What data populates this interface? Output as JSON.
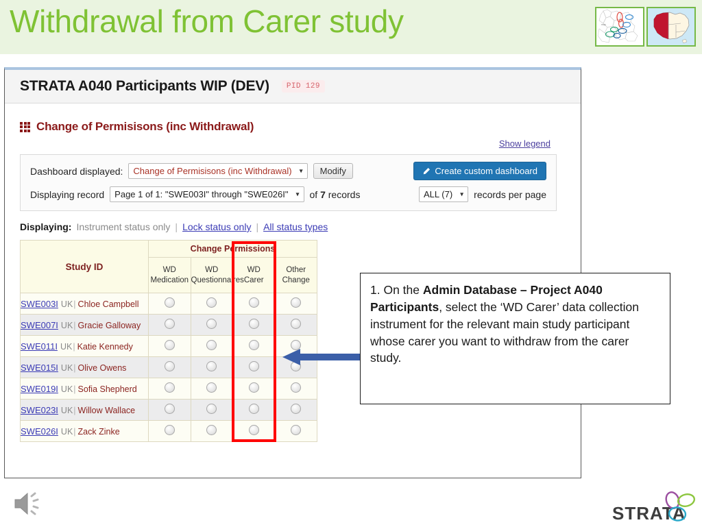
{
  "slide": {
    "title": "Withdrawal from Carer study",
    "title_color": "#7fc234",
    "banner_color": "#eaf4e0"
  },
  "maps": {
    "uk_label": "uk-map-thumbnail",
    "australia_label": "australia-map-thumbnail",
    "australia_highlight_color": "#c0152f"
  },
  "panel": {
    "title": "STRATA A040 Participants WIP (DEV)",
    "pid_badge": "PID 129",
    "section_title": "Change of Permisisons (inc Withdrawal)",
    "show_legend": "Show legend"
  },
  "controls": {
    "dashboard_label": "Dashboard displayed:",
    "dashboard_value": "Change of Permisisons (inc Withdrawal)",
    "modify_label": "Modify",
    "create_dashboard_label": "Create custom dashboard",
    "record_label": "Displaying record",
    "record_value": "Page 1 of 1: \"SWE003I\" through \"SWE026I\"",
    "of_records_prefix": "of ",
    "records_count": "7",
    "of_records_suffix": " records",
    "per_page_value": "ALL (7)",
    "per_page_label": "records per page"
  },
  "displaying": {
    "label": "Displaying:",
    "option_instrument": "Instrument status only",
    "option_lock": "Lock status only",
    "option_all": "All status types",
    "separator": "|"
  },
  "table": {
    "group_header": "Change Permissions",
    "columns": [
      {
        "id": "study_id",
        "label": "Study ID"
      },
      {
        "id": "wd_medication",
        "line1": "WD",
        "line2": "Medication"
      },
      {
        "id": "wd_questionnaires",
        "line1": "WD",
        "line2": "Questionnaires"
      },
      {
        "id": "wd_carer",
        "line1": "WD",
        "line2": "Carer"
      },
      {
        "id": "other_change",
        "line1": "Other",
        "line2": "Change"
      }
    ],
    "rows": [
      {
        "sid": "SWE003I",
        "country": "UK",
        "name": "Chloe Campbell"
      },
      {
        "sid": "SWE007I",
        "country": "UK",
        "name": "Gracie Galloway"
      },
      {
        "sid": "SWE011I",
        "country": "UK",
        "name": "Katie Kennedy"
      },
      {
        "sid": "SWE015I",
        "country": "UK",
        "name": "Olive Owens"
      },
      {
        "sid": "SWE019I",
        "country": "UK",
        "name": "Sofia Shepherd"
      },
      {
        "sid": "SWE023I",
        "country": "UK",
        "name": "Willow Wallace"
      },
      {
        "sid": "SWE026I",
        "country": "UK",
        "name": "Zack Zinke"
      }
    ],
    "highlight_column": "wd_carer",
    "highlight_color": "#ff0000"
  },
  "callout": {
    "number": "1.",
    "text_part1": " On the ",
    "bold1": "Admin Database – Project A040 Participants",
    "text_part2": ", select the ‘WD Carer’ data collection instrument for the relevant main study participant whose carer you want to withdraw from the carer study.",
    "arrow_color": "#3b5fa8"
  },
  "footer": {
    "speaker_icon": "speaker-icon",
    "logo_text": "STRATA",
    "logo_colors": [
      "#9b4fa0",
      "#8cc63e",
      "#29a8c9"
    ]
  }
}
